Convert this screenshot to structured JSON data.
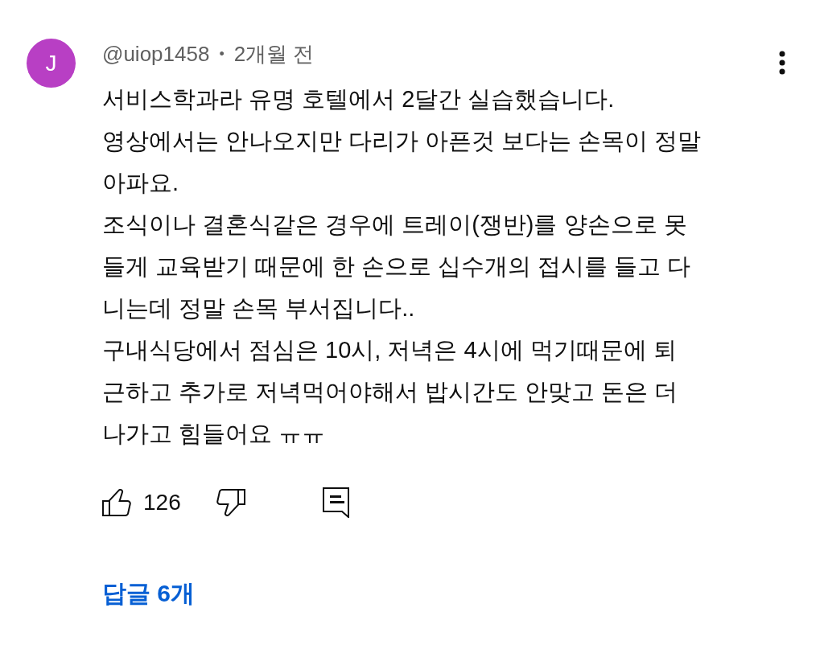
{
  "author": {
    "avatar_letter": "J",
    "handle": "@uiop1458",
    "separator": "•",
    "time": "2개월 전"
  },
  "comment": {
    "lines": [
      "서비스학과라 유명 호텔에서 2달간 실습했습니다.",
      "영상에서는 안나오지만 다리가 아픈것 보다는 손목이 정말",
      "아파요.",
      "조식이나 결혼식같은 경우에 트레이(쟁반)를 양손으로 못",
      "들게 교육받기 때문에 한 손으로 십수개의 접시를 들고 다",
      "니는데 정말 손목 부서집니다..",
      "구내식당에서 점심은 10시, 저녁은 4시에 먹기때문에 퇴",
      "근하고 추가로 저녁먹어야해서 밥시간도 안맞고 돈은 더",
      "나가고 힘들어요 ㅠㅠ"
    ]
  },
  "actions": {
    "like_count": "126"
  },
  "replies": {
    "label": "답글 6개"
  }
}
